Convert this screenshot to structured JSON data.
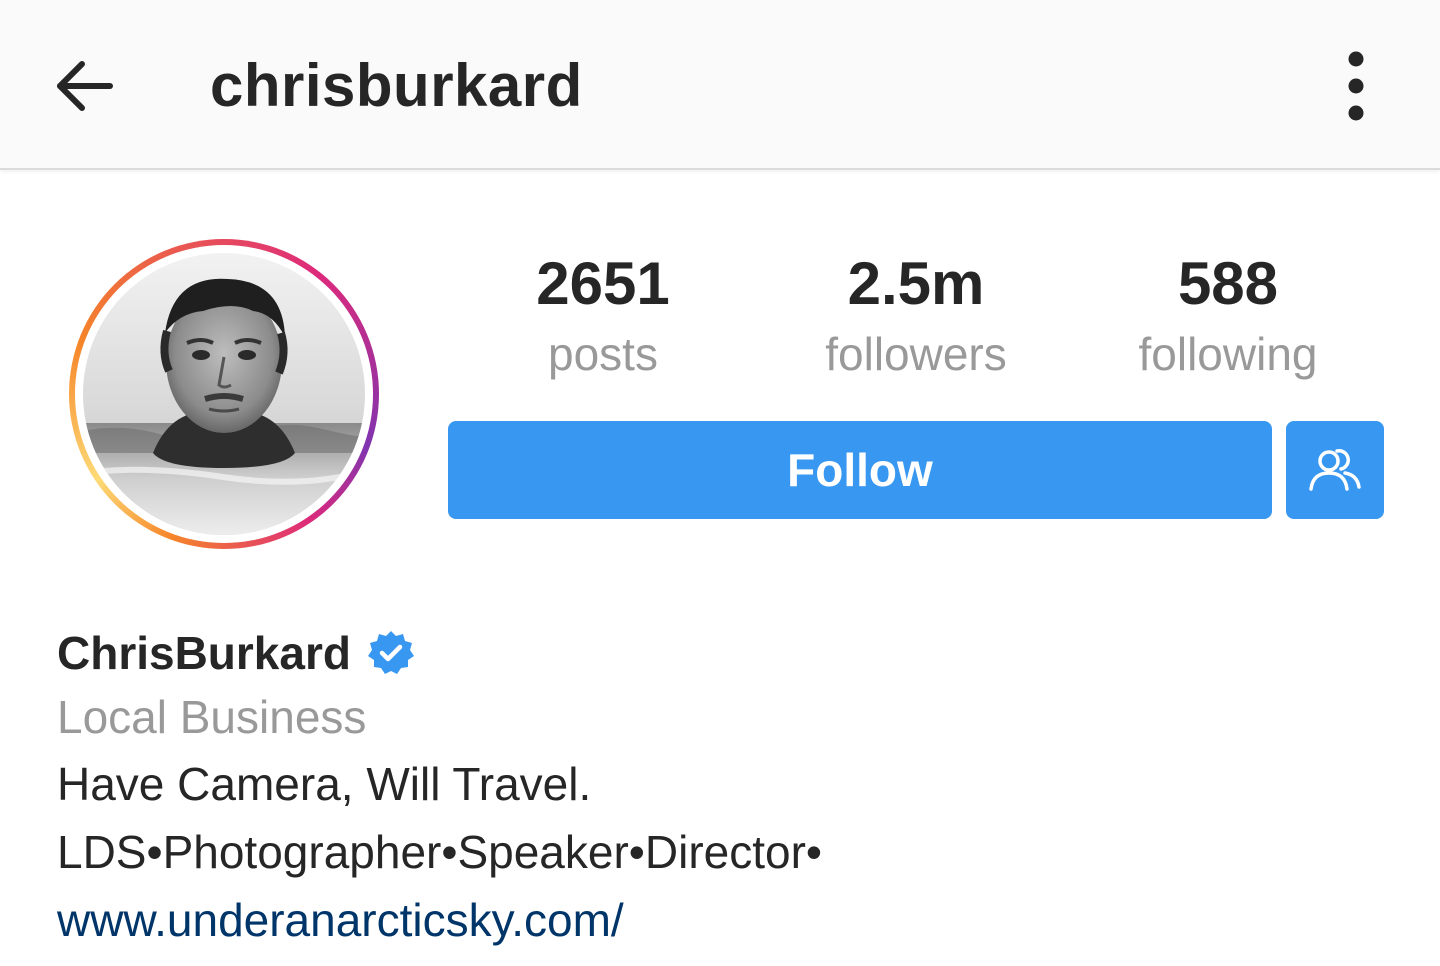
{
  "header": {
    "username": "chrisburkard",
    "back_icon": "arrow-left-icon",
    "more_icon": "vertical-dots-icon"
  },
  "profile": {
    "avatar_alt": "profile photo",
    "story_ring_colors": [
      "#f58529",
      "#dd2a7b",
      "#8134af"
    ]
  },
  "stats": {
    "posts": {
      "value": "2651",
      "label": "posts"
    },
    "followers": {
      "value": "2.5m",
      "label": "followers"
    },
    "following": {
      "value": "588",
      "label": "following"
    }
  },
  "actions": {
    "follow_label": "Follow",
    "suggested_icon": "people-outline-icon",
    "accent_color": "#3897f0"
  },
  "bio": {
    "full_name": "ChrisBurkard",
    "verified_icon": "verified-badge-icon",
    "category": "Local Business",
    "lines": [
      "Have Camera, Will Travel.",
      "LDS•Photographer•Speaker•Director•"
    ],
    "link": "www.underanarcticsky.com/",
    "link_color": "#003569"
  }
}
